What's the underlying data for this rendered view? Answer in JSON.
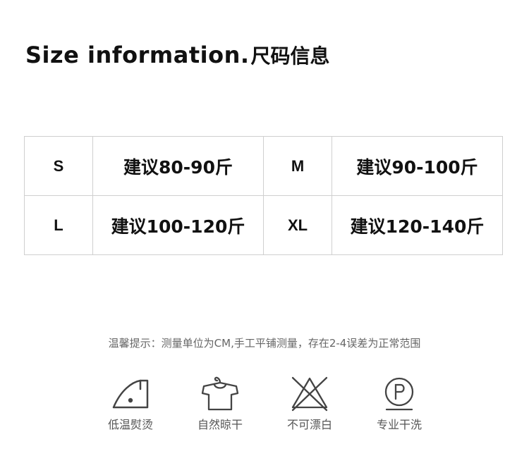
{
  "title": {
    "en": "Size information.",
    "cn": "尺码信息"
  },
  "size_table": {
    "rows": [
      [
        {
          "size": "S",
          "recommendation": "建议80-90斤"
        },
        {
          "size": "M",
          "recommendation": "建议90-100斤"
        }
      ],
      [
        {
          "size": "L",
          "recommendation": "建议100-120斤"
        },
        {
          "size": "XL",
          "recommendation": "建议120-140斤"
        }
      ]
    ]
  },
  "tip": "温馨提示：测量单位为CM,手工平铺测量，存在2-4误差为正常范围",
  "care": [
    {
      "icon": "iron-low-temp-icon",
      "label": "低温熨烫"
    },
    {
      "icon": "dry-naturally-icon",
      "label": "自然晾干"
    },
    {
      "icon": "do-not-bleach-icon",
      "label": "不可漂白"
    },
    {
      "icon": "professional-dry-clean-icon",
      "label": "专业干洗"
    }
  ],
  "colors": {
    "text": "#111111",
    "border": "#cfcfcf",
    "tip_text": "#666666",
    "icon_stroke": "#444444",
    "care_label": "#555555"
  }
}
